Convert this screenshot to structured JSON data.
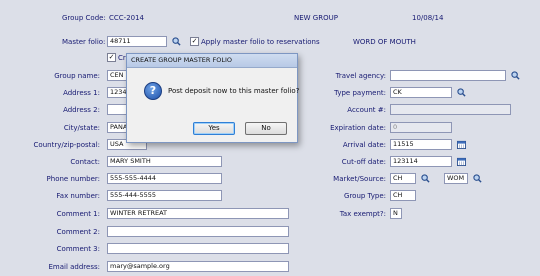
{
  "header": {
    "group_code_label": "Group Code:",
    "group_code_value": "CCC-2014",
    "status": "NEW GROUP",
    "date": "10/08/14"
  },
  "left": {
    "master_folio_label": "Master folio:",
    "master_folio_value": "48711",
    "apply_master_label": "Apply master folio to reservations",
    "apply_master_checked": "✓",
    "create_label": "Cr",
    "create_checked": "✓",
    "group_name_label": "Group name:",
    "group_name_value": "CEN",
    "address1_label": "Address 1:",
    "address1_value": "1234",
    "address2_label": "Address 2:",
    "address2_value": "",
    "city_label": "City/state:",
    "city_value": "PANA",
    "country_label": "Country/zip-postal:",
    "country_value": "USA",
    "contact_label": "Contact:",
    "contact_value": "MARY SMITH",
    "phone_label": "Phone number:",
    "phone_value": "555-555-4444",
    "fax_label": "Fax number:",
    "fax_value": "555-444-5555",
    "comment1_label": "Comment 1:",
    "comment1_value": "WINTER RETREAT",
    "comment2_label": "Comment 2:",
    "comment2_value": "",
    "comment3_label": "Comment 3:",
    "comment3_value": "",
    "email_label": "Email address:",
    "email_value": "mary@sample.org"
  },
  "right": {
    "source_text": "WORD OF MOUTH",
    "travel_agency_label": "Travel agency:",
    "travel_agency_value": "",
    "type_payment_label": "Type payment:",
    "type_payment_value": "CK",
    "account_label": "Account #:",
    "account_value": "",
    "expiration_label": "Expiration date:",
    "expiration_value": "0",
    "arrival_label": "Arrival date:",
    "arrival_value": "11515",
    "cutoff_label": "Cut-off date:",
    "cutoff_value": "123114",
    "market_label": "Market/Source:",
    "market_value": "CH",
    "source_value": "WOM",
    "group_type_label": "Group Type:",
    "group_type_value": "CH",
    "tax_label": "Tax exempt?:",
    "tax_value": "N"
  },
  "dialog": {
    "title": "CREATE GROUP MASTER FOLIO",
    "icon": "question-icon",
    "message": "Post deposit now to this master folio?",
    "yes_label": "Yes",
    "no_label": "No"
  },
  "colors": {
    "background": "#dcdfe8",
    "label_text": "#171a72"
  }
}
